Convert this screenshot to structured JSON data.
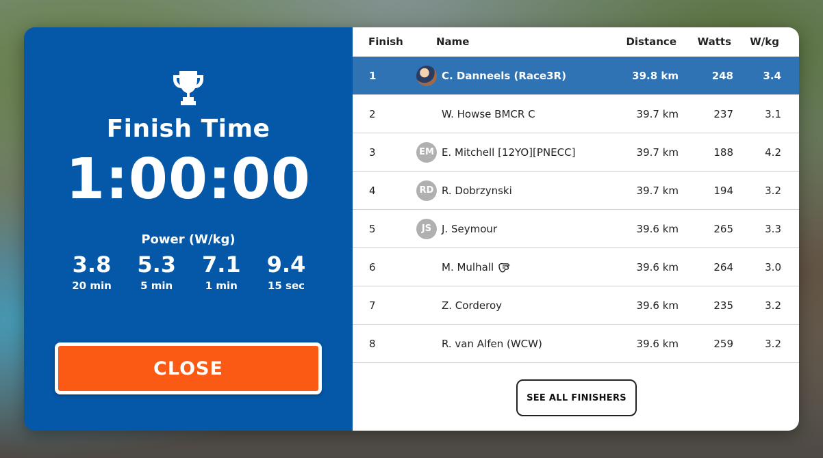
{
  "summary": {
    "title": "Finish Time",
    "time": "1:00:00",
    "power_label": "Power (W/kg)",
    "power": [
      {
        "value": "3.8",
        "duration": "20 min"
      },
      {
        "value": "5.3",
        "duration": "5 min"
      },
      {
        "value": "7.1",
        "duration": "1 min"
      },
      {
        "value": "9.4",
        "duration": "15 sec"
      }
    ],
    "close_label": "CLOSE"
  },
  "table": {
    "headers": {
      "finish": "Finish",
      "name": "Name",
      "distance": "Distance",
      "watts": "Watts",
      "wkg": "W/kg"
    },
    "rows": [
      {
        "pos": "1",
        "avatar": "",
        "name": "C. Danneels (Race3R)",
        "distance": "39.8 km",
        "watts": "248",
        "wkg": "3.4"
      },
      {
        "pos": "2",
        "avatar": "",
        "name": "W. Howse BMCR C",
        "distance": "39.7 km",
        "watts": "237",
        "wkg": "3.1"
      },
      {
        "pos": "3",
        "avatar": "EM",
        "name": "E. Mitchell [12YO][PNECC]",
        "distance": "39.7 km",
        "watts": "188",
        "wkg": "4.2"
      },
      {
        "pos": "4",
        "avatar": "RD",
        "name": "R. Dobrzynski",
        "distance": "39.7 km",
        "watts": "194",
        "wkg": "3.2"
      },
      {
        "pos": "5",
        "avatar": "JS",
        "name": "J. Seymour",
        "distance": "39.6 km",
        "watts": "265",
        "wkg": "3.3"
      },
      {
        "pos": "6",
        "avatar": "",
        "name": "M. Mulhall",
        "distance": "39.6 km",
        "watts": "264",
        "wkg": "3.0"
      },
      {
        "pos": "7",
        "avatar": "",
        "name": "Z. Corderoy",
        "distance": "39.6 km",
        "watts": "235",
        "wkg": "3.2"
      },
      {
        "pos": "8",
        "avatar": "",
        "name": "R. van Alfen (WCW)",
        "distance": "39.6 km",
        "watts": "259",
        "wkg": "3.2"
      }
    ],
    "see_all_label": "SEE ALL FINISHERS"
  },
  "colors": {
    "panel_blue": "#0558a7",
    "highlight_row": "#2f73b5",
    "close_orange": "#fa5a14"
  },
  "icons": {
    "trophy": "trophy-icon",
    "fist_badge": "fist-bump-icon"
  }
}
